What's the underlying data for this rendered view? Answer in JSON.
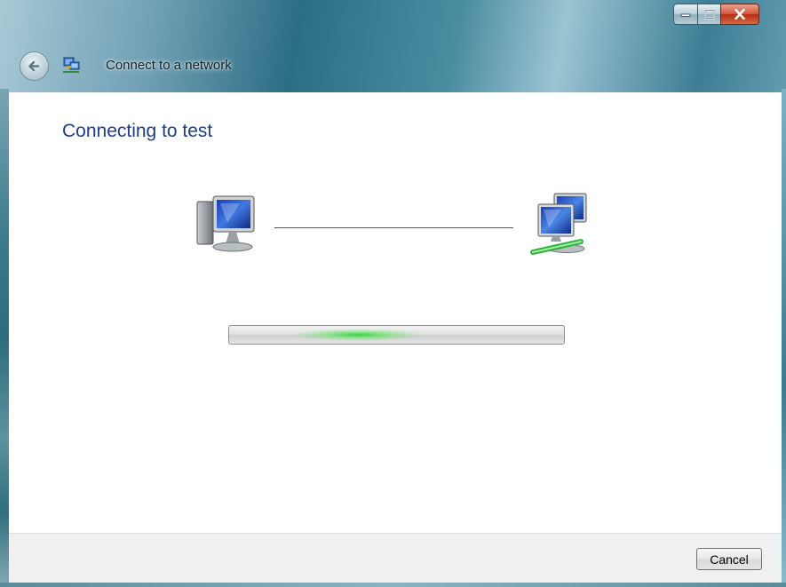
{
  "window": {
    "title": "Connect to a network"
  },
  "caption_buttons": {
    "minimize_icon": "minimize-icon",
    "maximize_icon": "maximize-icon",
    "close_icon": "close-icon"
  },
  "nav": {
    "back_icon": "back-arrow-icon",
    "app_icon": "network-icon"
  },
  "main": {
    "heading": "Connecting to test",
    "source_icon": "computer-icon",
    "target_icon": "network-computers-icon",
    "progress": {
      "state": "indeterminate",
      "accent_color": "#2ed73c"
    }
  },
  "footer": {
    "cancel_label": "Cancel"
  },
  "colors": {
    "heading": "#1e3c8f",
    "content_bg": "#ffffff",
    "footer_bg": "#f0f0f0"
  }
}
